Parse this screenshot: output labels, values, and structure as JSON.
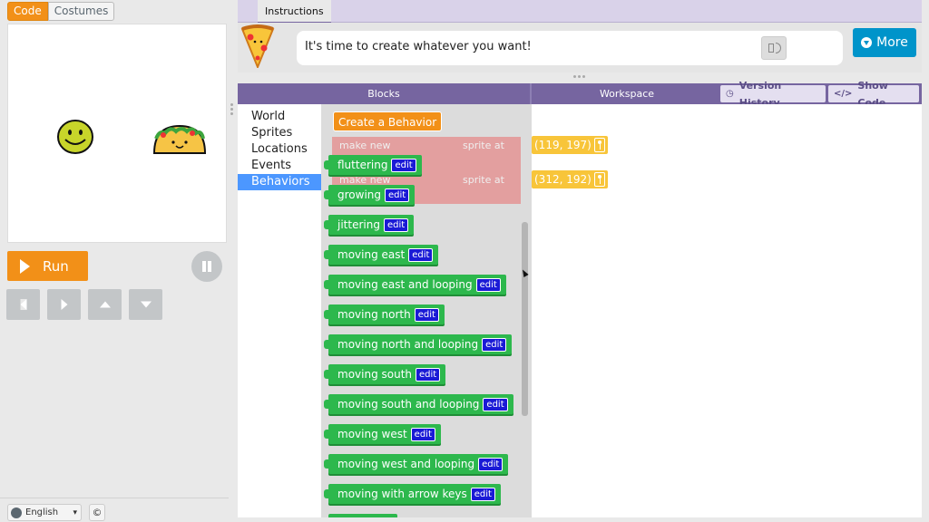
{
  "left_panel": {
    "code_tab": "Code",
    "costumes_tab": "Costumes",
    "run_label": "Run",
    "language": "English",
    "copyright_symbol": "©",
    "colors": {
      "run": "#f29018",
      "control": "#c3c6c8"
    }
  },
  "stage": {
    "sprites": [
      {
        "name": "smiley-face",
        "icon": "smiley-icon"
      },
      {
        "name": "taco",
        "icon": "taco-icon"
      }
    ]
  },
  "instructions": {
    "tab_label": "Instructions",
    "text": "It's time to create whatever you want!",
    "avatar_icon": "pizza-icon",
    "more_label": "More"
  },
  "editor": {
    "blocks_header": "Blocks",
    "workspace_header": "Workspace",
    "version_history_label": "Version History",
    "show_code_label": "Show Code",
    "categories": [
      "World",
      "Sprites",
      "Locations",
      "Events",
      "Behaviors"
    ],
    "selected_category": "Behaviors",
    "create_behavior_label": "Create a Behavior",
    "ghost_blocks": [
      {
        "make_new": "make new",
        "sprite_at": "sprite at"
      },
      {
        "make_new": "make new",
        "sprite_at": "sprite at"
      }
    ],
    "edit_label": "edit",
    "behaviors": [
      "fluttering",
      "growing",
      "jittering",
      "moving east",
      "moving east and looping",
      "moving north",
      "moving north and looping",
      "moving south",
      "moving south and looping",
      "moving west",
      "moving west and looping",
      "moving with arrow keys"
    ],
    "workspace_coords": [
      "(119, 197)",
      "(312, 192)"
    ],
    "colors": {
      "header": "#7665a0",
      "behavior_block": "#2db84d",
      "edit_badge": "#1a1ad6",
      "location_block": "#f8c53a"
    }
  }
}
